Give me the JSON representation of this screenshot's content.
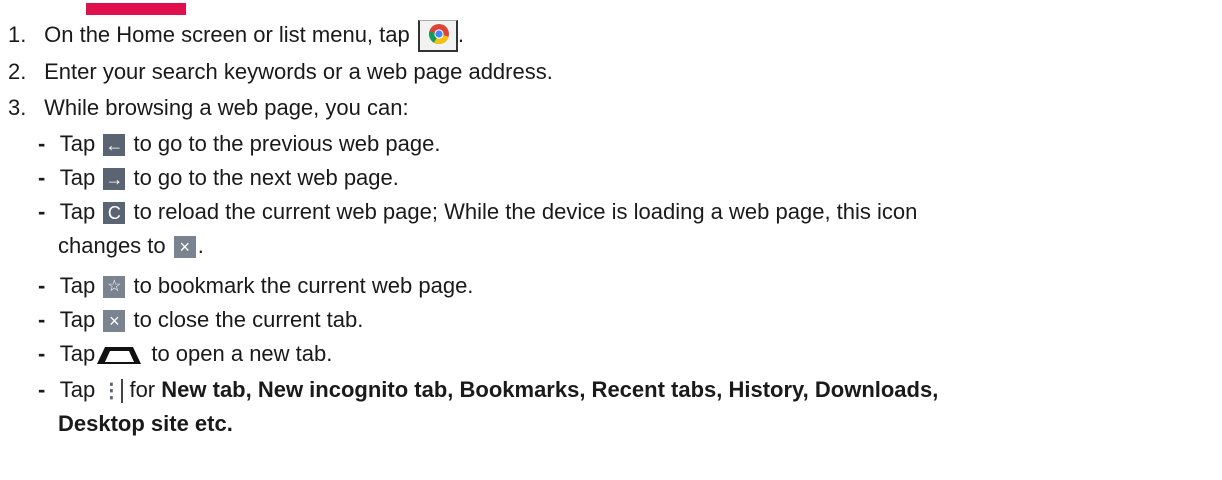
{
  "steps": [
    {
      "num": "1.",
      "text_a": "On the Home screen or list menu, tap",
      "text_b": "."
    },
    {
      "num": "2.",
      "text": "Enter your search keywords or a web page address."
    },
    {
      "num": "3.",
      "text": "While browsing a web page, you can:"
    }
  ],
  "bullets": {
    "dash": "-",
    "tap": "Tap",
    "back": {
      "text": "to go to the previous web page.",
      "icon": "arrow-left-icon",
      "glyph": "←"
    },
    "forward": {
      "text": "to go to the next web page.",
      "icon": "arrow-right-icon",
      "glyph": "→"
    },
    "reload": {
      "text": "to reload the current web page; While the device is loading a web page, this icon",
      "continuation": "changes to",
      "period": ".",
      "icon": "reload-icon",
      "glyph": "C",
      "stop_glyph": "×"
    },
    "bookmark": {
      "text": "to bookmark the current web page.",
      "icon": "star-icon",
      "glyph": "☆"
    },
    "close_tab": {
      "text": "to close the current tab.",
      "icon": "close-icon",
      "glyph": "×"
    },
    "new_tab": {
      "text": "to open a new tab.",
      "icon": "new-tab-icon"
    },
    "menu": {
      "text_pre": "for",
      "bold_line1": "New tab, New incognito tab, Bookmarks, Recent tabs, History, Downloads,",
      "bold_line2": "Desktop site etc.",
      "icon": "more-menu-icon",
      "glyph": "⋮"
    }
  },
  "colors": {
    "heading": "#e0104f",
    "icon_bg": "#5b6472",
    "text": "#1a1a1a"
  }
}
